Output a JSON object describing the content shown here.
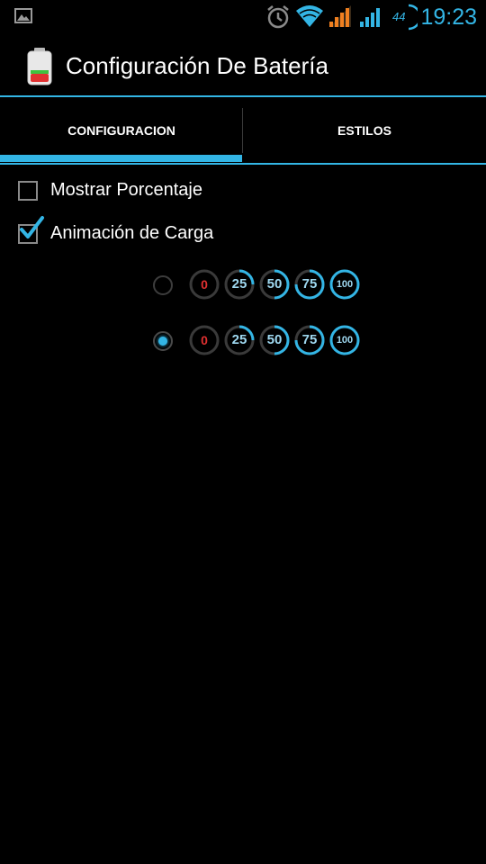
{
  "status_bar": {
    "time": "19:23",
    "network_label": "44",
    "icons": [
      "gallery-icon",
      "alarm-icon",
      "wifi-icon",
      "signal-orange-icon",
      "signal-blue-icon",
      "data-4g-icon"
    ]
  },
  "action_bar": {
    "title": "Configuración De Batería",
    "icon": "battery-icon"
  },
  "tabs": [
    {
      "label": "CONFIGURACION",
      "selected": true
    },
    {
      "label": "ESTILOS",
      "selected": false
    }
  ],
  "settings": [
    {
      "label": "Mostrar Porcentaje",
      "checked": false
    },
    {
      "label": "Animación de Carga",
      "checked": true
    }
  ],
  "style_options": [
    {
      "selected": false,
      "badges": [
        "0",
        "25",
        "50",
        "75",
        "100"
      ]
    },
    {
      "selected": true,
      "badges": [
        "0",
        "25",
        "50",
        "75",
        "100"
      ]
    }
  ],
  "colors": {
    "accent": "#33b5e5",
    "background": "#000000",
    "zero_badge": "#e03030"
  }
}
